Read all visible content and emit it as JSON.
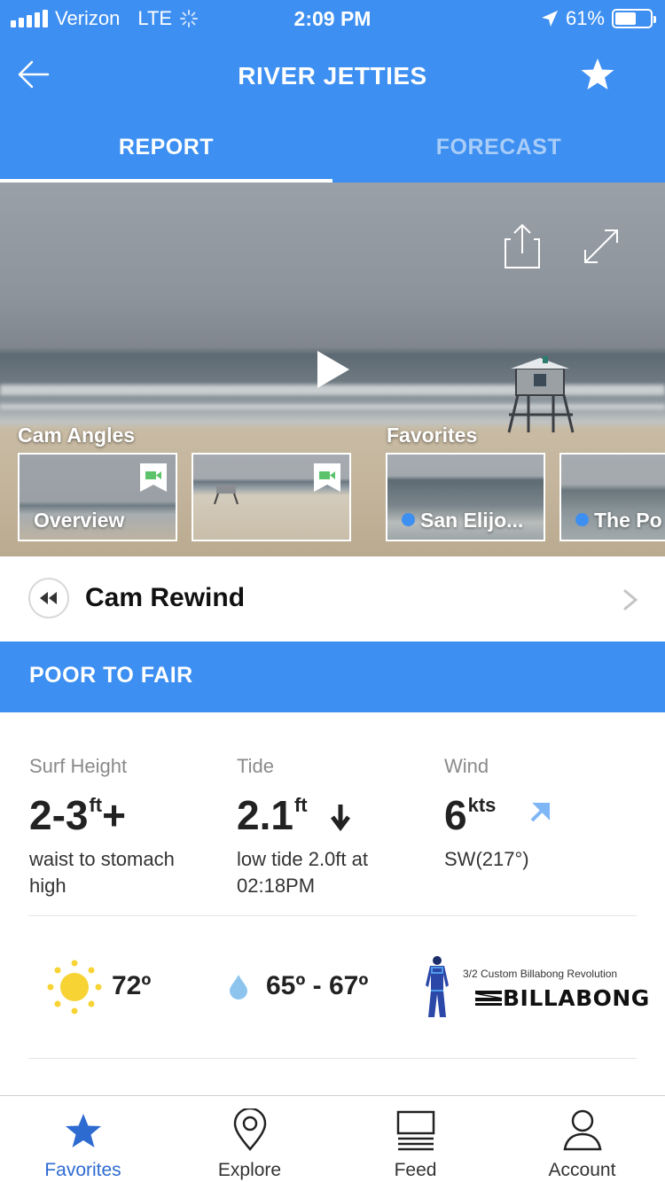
{
  "status_bar": {
    "carrier": "Verizon",
    "network": "LTE",
    "time": "2:09 PM",
    "battery": "61%",
    "battery_level": 0.61
  },
  "nav": {
    "title": "RIVER JETTIES",
    "back_icon": "arrow-left-icon",
    "favorite_icon": "star-icon"
  },
  "tabs": [
    {
      "label": "REPORT",
      "active": true
    },
    {
      "label": "FORECAST",
      "active": false
    }
  ],
  "cam": {
    "share_icon": "share-icon",
    "expand_icon": "expand-icon",
    "play_icon": "play-icon",
    "angles_label": "Cam Angles",
    "favorites_label": "Favorites",
    "angles": [
      {
        "name": "Overview"
      },
      {
        "name": ""
      }
    ],
    "favorites": [
      {
        "name": "San Elijo..."
      },
      {
        "name": "The Po"
      }
    ]
  },
  "rewind": {
    "label": "Cam Rewind",
    "icon": "rewind-icon"
  },
  "condition": {
    "label": "POOR TO FAIR",
    "color": "#3d8ff1"
  },
  "stats": {
    "surf": {
      "label": "Surf Height",
      "value": "2-3",
      "unit": "ft",
      "suffix": "+",
      "desc": "waist to stomach high"
    },
    "tide": {
      "label": "Tide",
      "value": "2.1",
      "unit": "ft",
      "desc": "low tide 2.0ft at 02:18PM",
      "direction_icon": "arrow-down-icon"
    },
    "wind": {
      "label": "Wind",
      "value": "6",
      "unit": "kts",
      "desc": "SW(217°)",
      "direction_icon": "wind-arrow-icon"
    }
  },
  "weather": {
    "air_temp": "72º",
    "water_temp": "65º - 67º",
    "wetsuit_label": "3/2 Custom Billabong Revolution",
    "brand": "BILLABONG"
  },
  "tabbar": [
    {
      "label": "Favorites",
      "icon": "star-icon",
      "active": true
    },
    {
      "label": "Explore",
      "icon": "map-pin-icon",
      "active": false
    },
    {
      "label": "Feed",
      "icon": "feed-icon",
      "active": false
    },
    {
      "label": "Account",
      "icon": "user-icon",
      "active": false
    }
  ],
  "colors": {
    "brand_blue": "#3d8ff1",
    "active_tab": "#2e6bd1",
    "inactive_tab_text": "#a9cdf8"
  }
}
